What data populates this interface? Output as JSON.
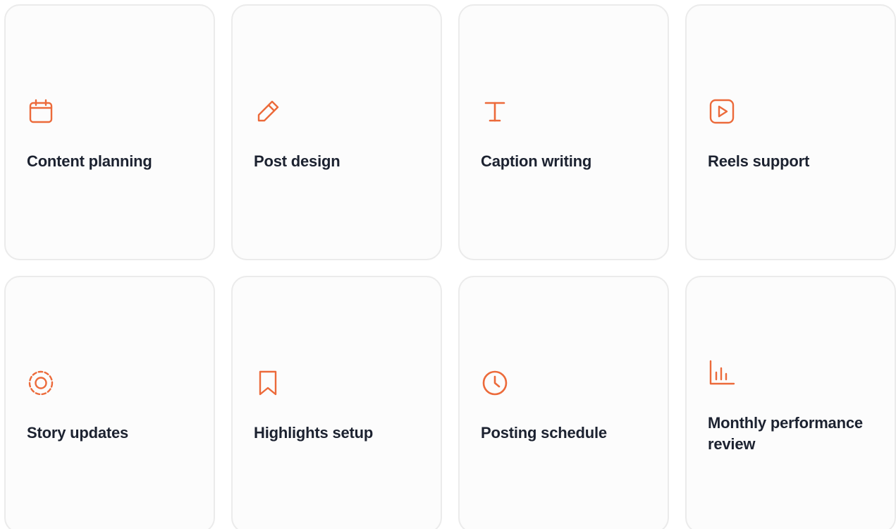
{
  "accent_color": "#ec6a3a",
  "services": [
    {
      "label": "Content planning",
      "icon": "calendar-icon"
    },
    {
      "label": "Post design",
      "icon": "pencil-icon"
    },
    {
      "label": "Caption writing",
      "icon": "text-cursor-icon"
    },
    {
      "label": "Reels support",
      "icon": "play-icon"
    },
    {
      "label": "Story updates",
      "icon": "story-ring-icon"
    },
    {
      "label": "Highlights setup",
      "icon": "bookmark-icon"
    },
    {
      "label": "Posting schedule",
      "icon": "clock-icon"
    },
    {
      "label": "Monthly performance review",
      "icon": "bar-chart-icon"
    }
  ]
}
